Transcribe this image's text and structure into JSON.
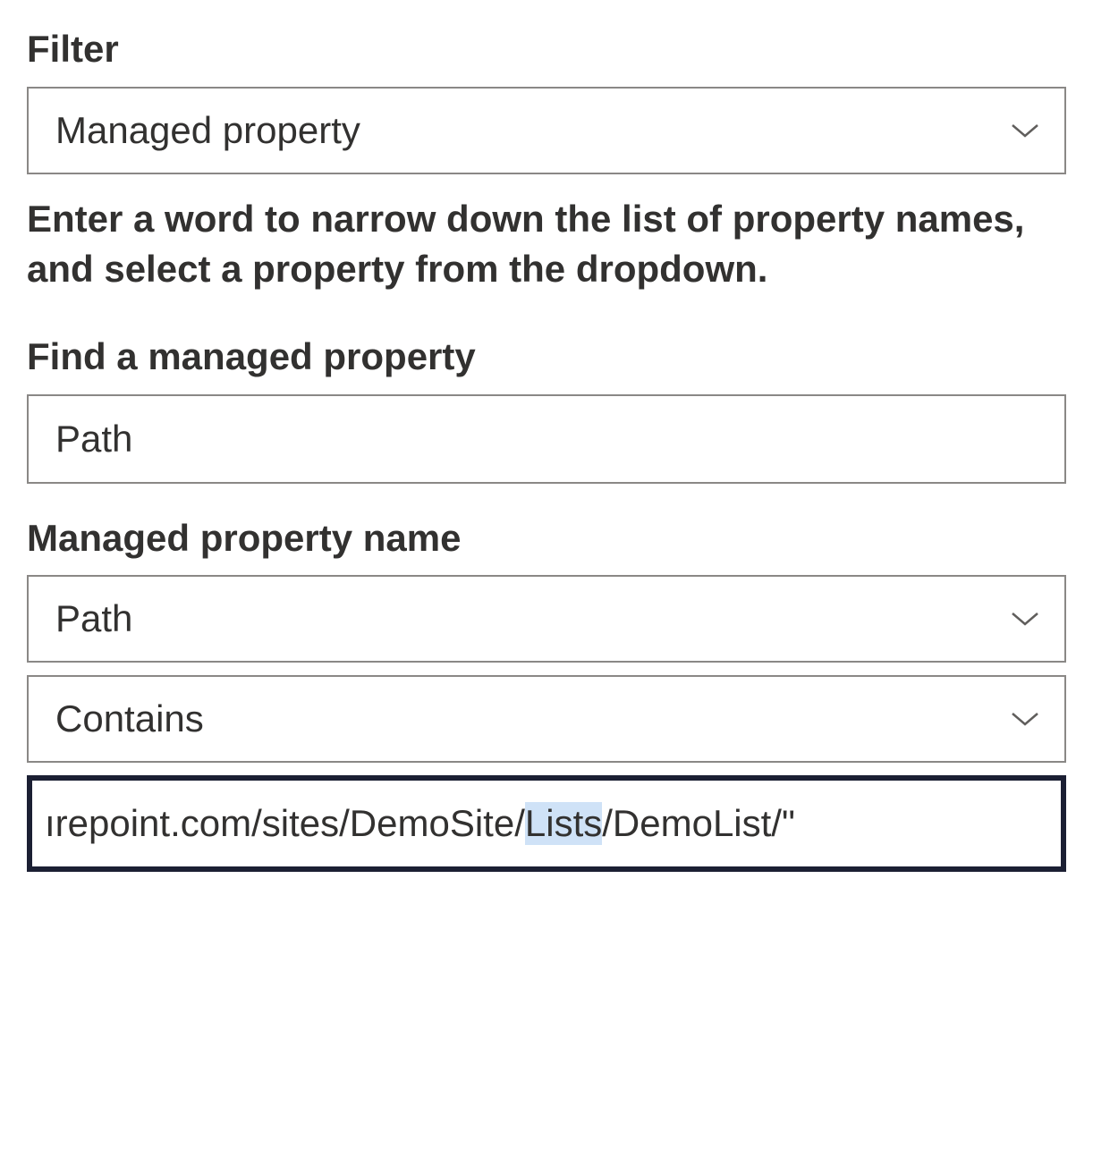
{
  "filter": {
    "label": "Filter",
    "selected": "Managed property",
    "help_text": "Enter a word to narrow down the list of property names, and select a property from the dropdown."
  },
  "find_property": {
    "label": "Find a managed property",
    "value": "Path"
  },
  "property_name": {
    "label": "Managed property name",
    "selected": "Path"
  },
  "operator": {
    "selected": "Contains"
  },
  "value_input": {
    "pre": "ırepoint.com/sites/DemoSite/",
    "highlight": "Lists",
    "post": "/DemoList/\""
  }
}
